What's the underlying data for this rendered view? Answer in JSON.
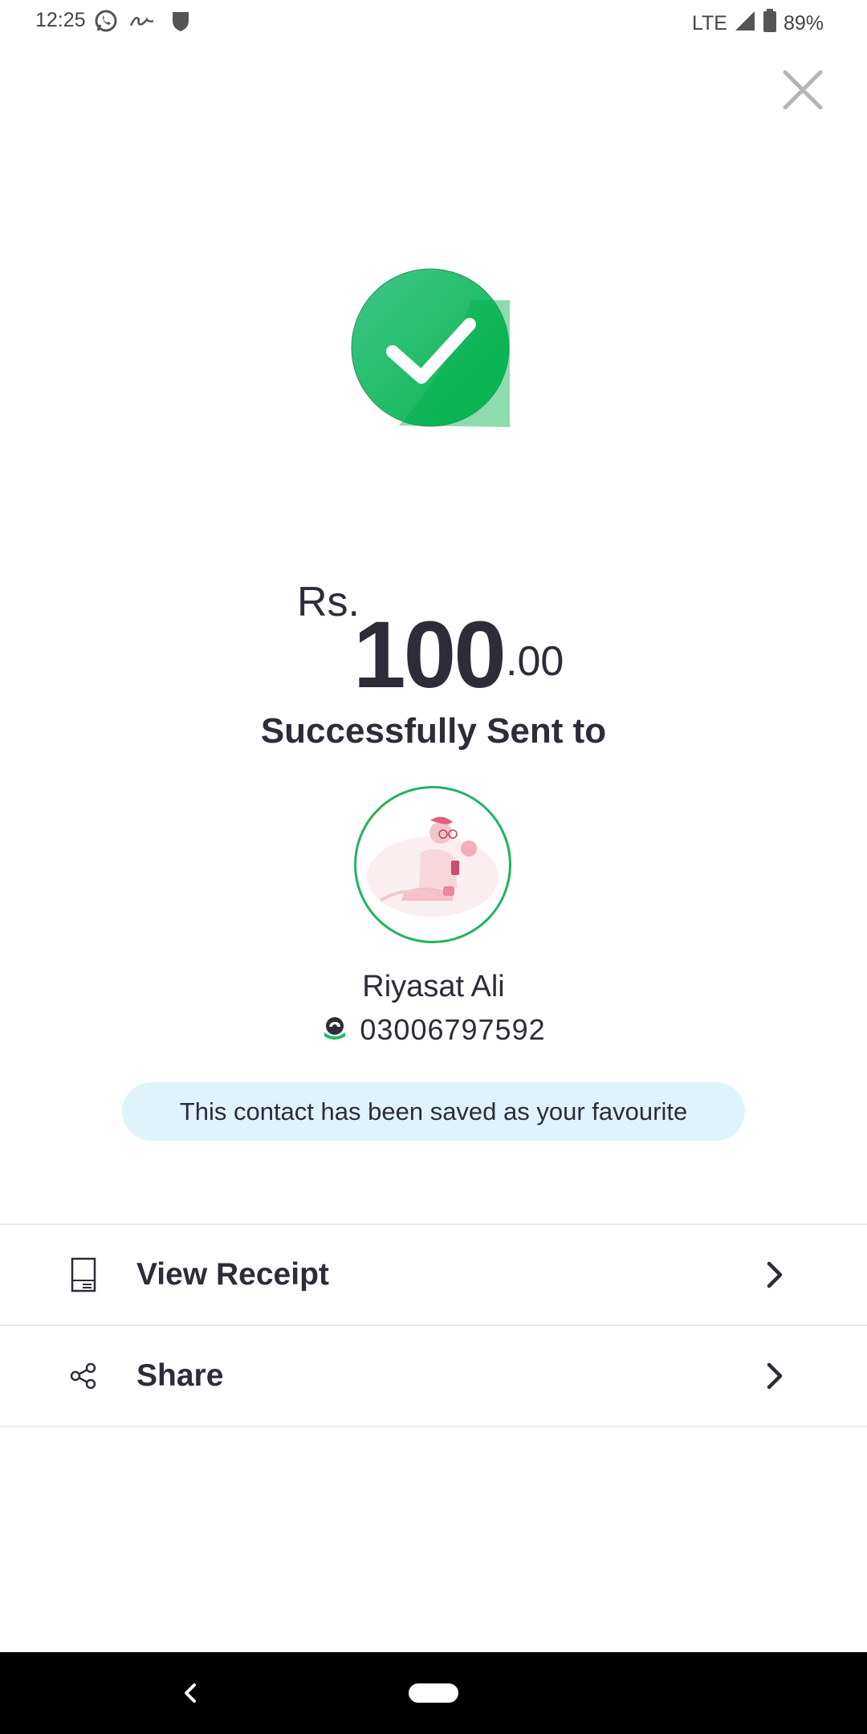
{
  "status_bar": {
    "time": "12:25",
    "network": "LTE",
    "battery": "89%",
    "icons": [
      "whatsapp-icon",
      "signature-icon",
      "shield-icon",
      "signal-icon",
      "battery-icon"
    ]
  },
  "close": {
    "icon": "close-icon"
  },
  "success": {
    "icon": "check-circle-icon",
    "color": "#1fbd63"
  },
  "amount": {
    "prefix": "Rs.",
    "whole": "100",
    "decimal": ".00"
  },
  "title": "Successfully Sent to",
  "contact": {
    "name": "Riyasat Ali",
    "phone": "03006797592",
    "wallet_icon": "easypaisa-icon"
  },
  "favourite_banner": "This contact has been saved as your favourite",
  "actions": [
    {
      "label": "View Receipt",
      "icon": "receipt-icon"
    },
    {
      "label": "Share",
      "icon": "share-icon"
    }
  ],
  "colors": {
    "accent_green": "#22b35e",
    "banner_bg": "#dff3fb",
    "text": "#2d2c39"
  },
  "nav": {
    "back_icon": "back-icon",
    "home_icon": "home-pill-icon"
  }
}
